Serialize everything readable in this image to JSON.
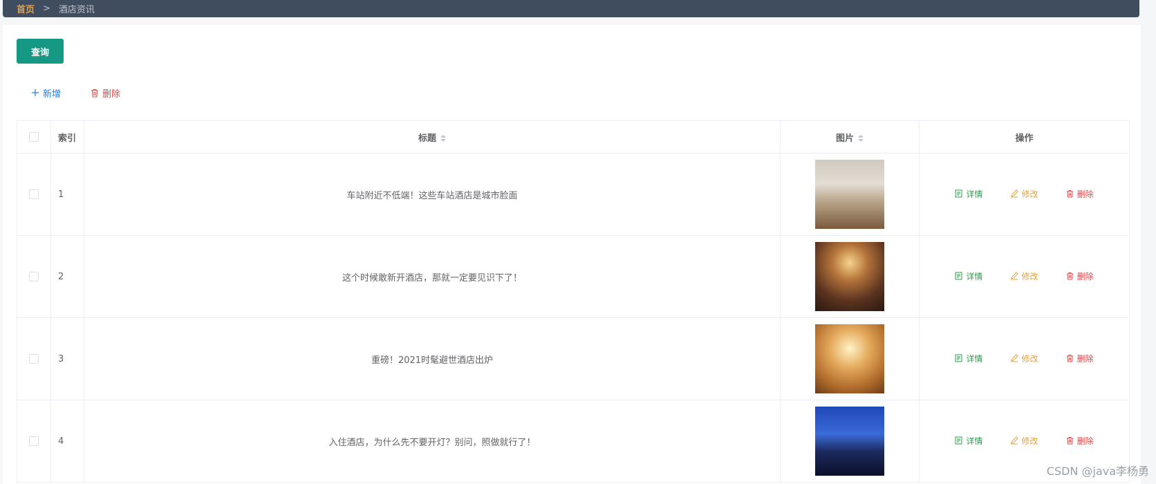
{
  "breadcrumb": {
    "home": "首页",
    "separator": ">",
    "current": "酒店资讯"
  },
  "toolbar": {
    "query_label": "查询",
    "add_label": "新增",
    "delete_label": "删除"
  },
  "table": {
    "headers": {
      "index": "索引",
      "title": "标题",
      "image": "图片",
      "ops": "操作"
    },
    "rows": [
      {
        "index": "1",
        "title": "车站附近不低端！这些车站酒店是城市脸面"
      },
      {
        "index": "2",
        "title": "这个时候敢新开酒店，那就一定要见识下了！"
      },
      {
        "index": "3",
        "title": "重磅！2021时髦避世酒店出炉"
      },
      {
        "index": "4",
        "title": "入住酒店，为什么先不要开灯？别问，照做就行了！"
      }
    ],
    "ops": {
      "detail": "详情",
      "edit": "修改",
      "delete": "删除"
    }
  },
  "watermark": "CSDN @java李杨勇",
  "colors": {
    "header_bg": "#3f4d5e",
    "primary": "#159985",
    "link_blue": "#1f7fe8",
    "danger": "#e04848",
    "success": "#2a9d4a",
    "warning": "#e6a23c"
  }
}
